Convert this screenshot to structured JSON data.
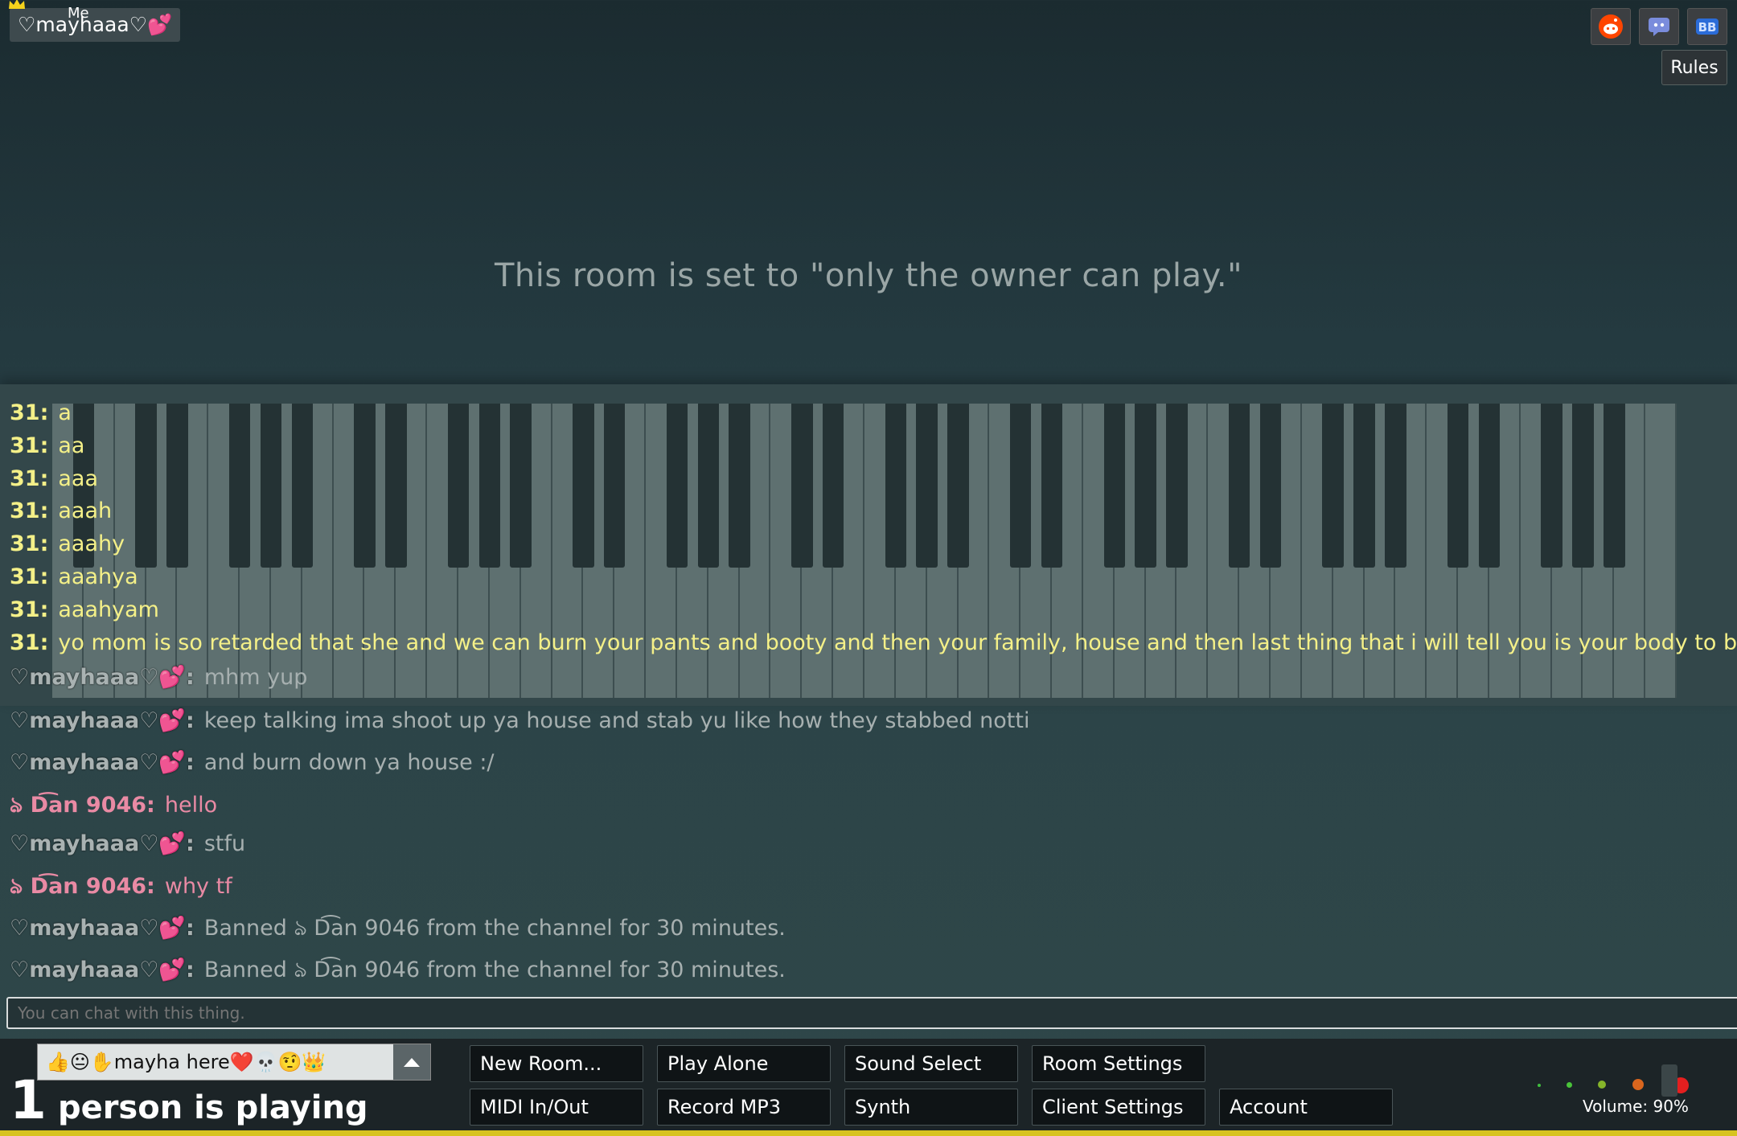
{
  "user_badge": {
    "name": "♡mayhaaa♡💕",
    "me_label": "Me"
  },
  "top_icons": [
    {
      "name": "reddit-icon",
      "color": "#ff4500"
    },
    {
      "name": "discord-icon",
      "color": "#7a8cdc"
    },
    {
      "name": "bb-icon",
      "label": "BB",
      "color": "#2b6cd8"
    }
  ],
  "rules_label": "Rules",
  "room_message": "This room is set to \"only the owner can play.\"",
  "chat": [
    {
      "who": "31:",
      "text": "a",
      "style": "y"
    },
    {
      "who": "31:",
      "text": "aa",
      "style": "y"
    },
    {
      "who": "31:",
      "text": "aaa",
      "style": "y"
    },
    {
      "who": "31:",
      "text": "aaah",
      "style": "y"
    },
    {
      "who": "31:",
      "text": "aaahy",
      "style": "y"
    },
    {
      "who": "31:",
      "text": "aaahya",
      "style": "y"
    },
    {
      "who": "31:",
      "text": "aaahyam",
      "style": "y"
    },
    {
      "who": "31:",
      "text": "yo mom is so retarded that she and we can burn your pants and booty and then your family, house and then last thing that i will tell you is your body to burn.",
      "style": "y"
    },
    {
      "who": "♡mayhaaa♡💕:",
      "text": "mhm yup",
      "style": "g"
    },
    {
      "who": "♡mayhaaa♡💕:",
      "text": "keep talking ima shoot up ya house and stab yu like how they stabbed notti",
      "style": "g"
    },
    {
      "who": "♡mayhaaa♡💕:",
      "text": "and burn down ya house :/",
      "style": "g"
    },
    {
      "who": "ঌ D͡an 9046:",
      "text": "hello",
      "style": "p"
    },
    {
      "who": "♡mayhaaa♡💕:",
      "text": "stfu",
      "style": "g"
    },
    {
      "who": "ঌ D͡an 9046:",
      "text": "why tf",
      "style": "p"
    },
    {
      "who": "♡mayhaaa♡💕:",
      "text": "Banned ঌ D͡an 9046 from the channel for 30 minutes.",
      "style": "g"
    },
    {
      "who": "♡mayhaaa♡💕:",
      "text": "Banned ঌ D͡an 9046 from the channel for 30 minutes.",
      "style": "g"
    }
  ],
  "chat_input_placeholder": "You can chat with this thing.",
  "status_text": "👍😐✋mayha here❤️💀🤨👑",
  "players": {
    "count": "1",
    "label": "person is playing"
  },
  "buttons": {
    "new_room": "New Room...",
    "play_alone": "Play Alone",
    "sound_select": "Sound Select",
    "room_settings": "Room Settings",
    "midi": "MIDI In/Out",
    "record_mp3": "Record MP3",
    "synth": "Synth",
    "client_settings": "Client Settings",
    "account": "Account"
  },
  "volume_label": "Volume: 90%",
  "colors": {
    "accent_yellow": "#d7c320",
    "chat_yellow": "#f4f088",
    "chat_pink": "#e98aa4"
  }
}
